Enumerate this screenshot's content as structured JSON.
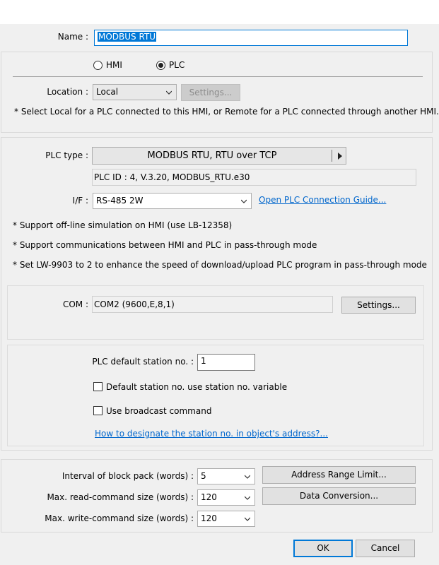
{
  "name": {
    "label": "Name :",
    "value": "MODBUS RTU"
  },
  "device_type": {
    "options": [
      {
        "label": "HMI",
        "selected": false
      },
      {
        "label": "PLC",
        "selected": true
      }
    ]
  },
  "location": {
    "label": "Location :",
    "value": "Local",
    "settings_button": "Settings...",
    "note": "* Select Local for a PLC connected to this HMI, or Remote for a PLC connected through another HMI."
  },
  "plc": {
    "type_label": "PLC type :",
    "type_value": "MODBUS RTU, RTU over TCP",
    "id_text": "PLC ID : 4, V.3.20, MODBUS_RTU.e30",
    "if_label": "I/F :",
    "if_value": "RS-485 2W",
    "guide_link": "Open PLC Connection Guide...",
    "notes": [
      "* Support off-line simulation on HMI (use LB-12358)",
      "* Support communications between HMI and PLC in pass-through mode",
      "* Set LW-9903 to 2 to enhance the speed of download/upload PLC program in pass-through mode"
    ]
  },
  "com": {
    "label": "COM :",
    "value": "COM2 (9600,E,8,1)",
    "settings_button": "Settings..."
  },
  "station": {
    "default_label": "PLC default station no. :",
    "default_value": "1",
    "use_variable_label": "Default station no. use station no. variable",
    "use_variable_checked": false,
    "broadcast_label": "Use broadcast command",
    "broadcast_checked": false,
    "help_link": "How to designate the station no. in object's address?..."
  },
  "block": {
    "interval_label": "Interval of block pack (words) :",
    "interval_value": "5",
    "read_label": "Max. read-command size (words) :",
    "read_value": "120",
    "write_label": "Max. write-command size (words) :",
    "write_value": "120",
    "address_range_button": "Address Range Limit...",
    "data_conversion_button": "Data Conversion..."
  },
  "footer": {
    "ok_button": "OK",
    "cancel_button": "Cancel"
  },
  "colors": {
    "accent": "#0078d7",
    "link": "#0066cc",
    "background": "#f0f0f0"
  },
  "icons": {
    "dropdown": "chevron-down-icon",
    "arrow": "arrow-right-icon"
  }
}
